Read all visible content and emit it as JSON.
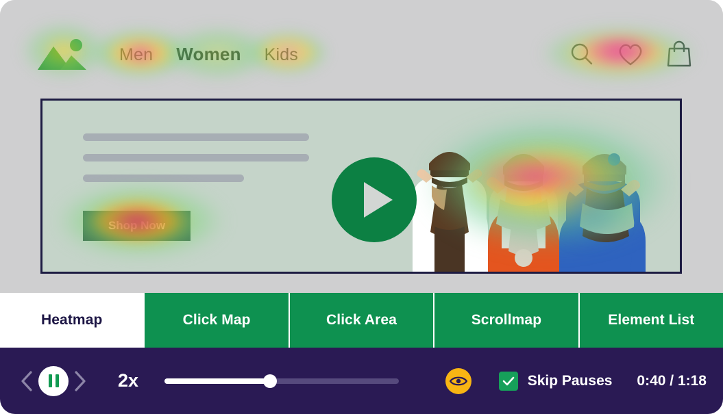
{
  "site": {
    "logo_icon": "mountain-logo-icon",
    "nav_links": [
      {
        "label": "Men",
        "active": false
      },
      {
        "label": "Women",
        "active": true
      },
      {
        "label": "Kids",
        "active": false
      }
    ],
    "icons": [
      {
        "name": "search-icon"
      },
      {
        "name": "heart-icon"
      },
      {
        "name": "shopping-bag-icon"
      }
    ],
    "hero": {
      "cta_label": "Shop Now",
      "play_icon": "play-icon",
      "photo_alt": "three-women-in-knit-hats"
    }
  },
  "tabs": [
    {
      "label": "Heatmap",
      "active": true
    },
    {
      "label": "Click Map",
      "active": false
    },
    {
      "label": "Click Area",
      "active": false
    },
    {
      "label": "Scrollmap",
      "active": false
    },
    {
      "label": "Element List",
      "active": false
    }
  ],
  "player": {
    "prev_icon": "chevron-left-icon",
    "play_pause_icon": "pause-icon",
    "next_icon": "chevron-right-icon",
    "speed": "2x",
    "progress_percent": 45,
    "eye_icon": "eye-icon",
    "skip_pauses_label": "Skip Pauses",
    "skip_pauses_checked": true,
    "timecode": "0:40 / 1:18"
  },
  "colors": {
    "tab_green": "#0e9150",
    "player_purple": "#2a1a54",
    "accent_amber": "#f8b513",
    "check_green": "#16a05a",
    "page_bg": "#cfcfd0"
  }
}
